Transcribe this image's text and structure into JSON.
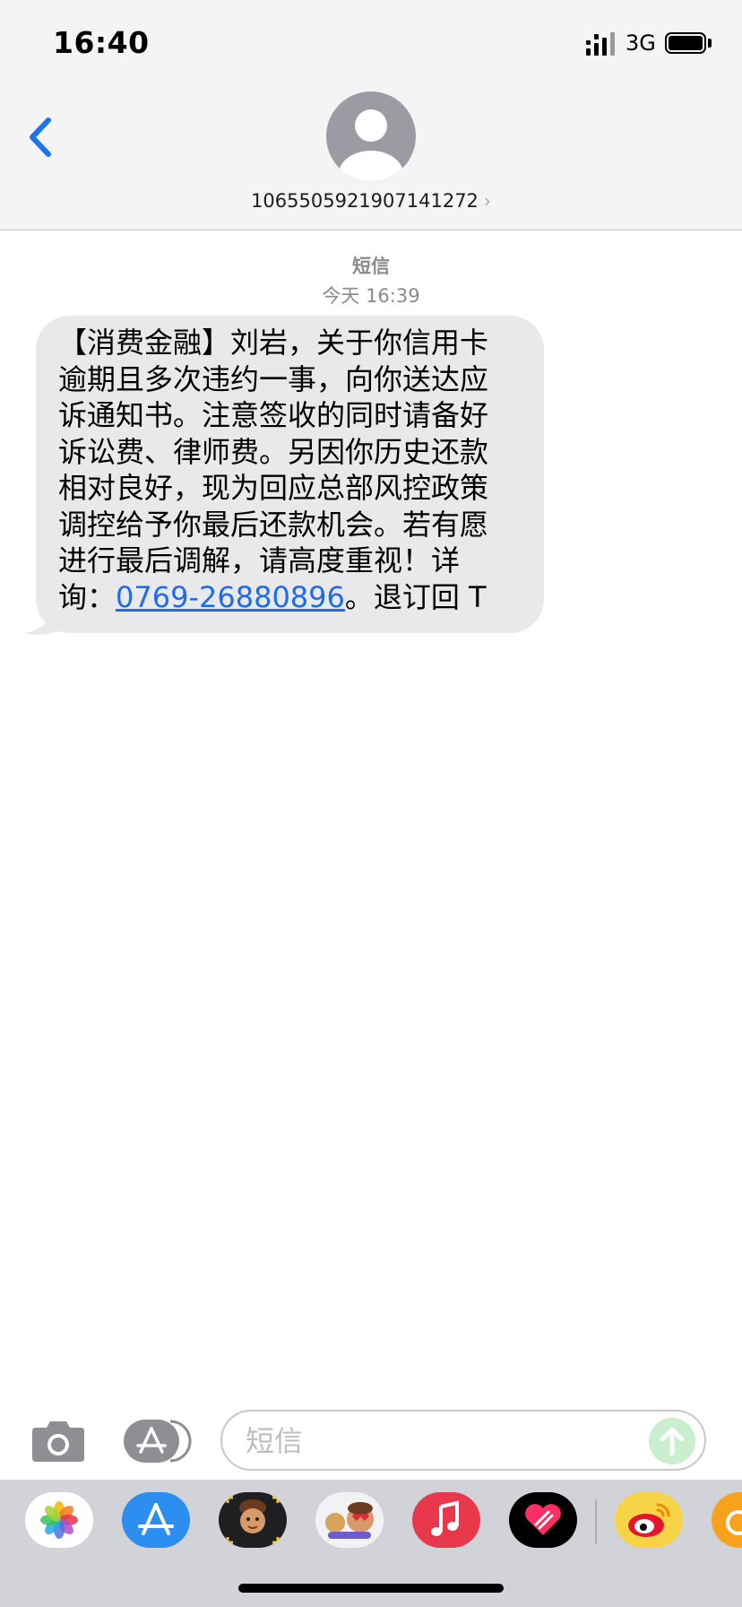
{
  "status_bar": {
    "time": "16:40",
    "network": "3G"
  },
  "header": {
    "sender": "1065505921907141272",
    "chevron": "›"
  },
  "conversation": {
    "service": "短信",
    "timestamp": "今天 16:39"
  },
  "message": {
    "lines": [
      "【消费金融】刘岩，关于你信用卡",
      "逾期且多次违约一事，向你送达应",
      "诉通知书。注意签收的同时请备好",
      "诉讼费、律师费。另因你历史还款",
      "相对良好，现为回应总部风控政策",
      "调控给予你最后还款机会。若有愿",
      "进行最后调解，请高度重视！详"
    ],
    "last_line_prefix": "询：",
    "phone": "0769-26880896",
    "last_line_suffix": "。退订回 T"
  },
  "input": {
    "placeholder": "短信"
  },
  "colors": {
    "accent": "#1d6cf0",
    "bubble": "#e9e9eb",
    "header_bg": "#f4f4f5",
    "drawer_bg": "#d2d3d8"
  },
  "drawer_apps": [
    "photos-icon",
    "app-store-icon",
    "memoji-icon",
    "animoji-stickers-icon",
    "music-icon",
    "digital-touch-icon",
    "weibo-icon",
    "app-partial-icon"
  ]
}
